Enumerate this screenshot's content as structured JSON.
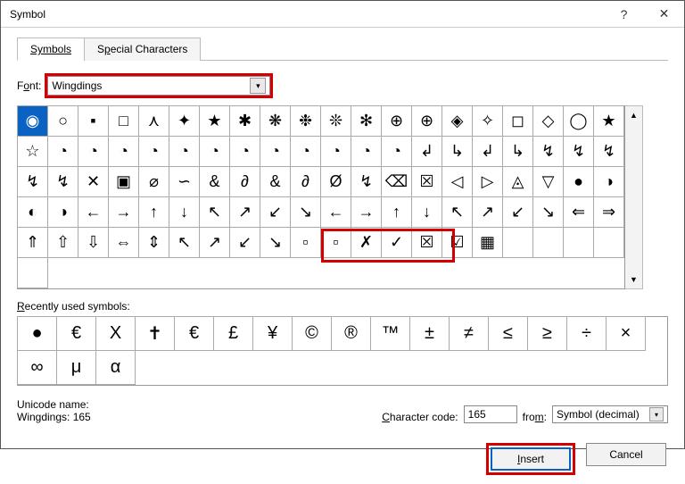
{
  "titlebar": {
    "title": "Symbol"
  },
  "tabs": {
    "symbols": "Symbols",
    "special": "Special Characters"
  },
  "fontrow": {
    "label_pre": "F",
    "label_u": "o",
    "label_post": "nt:",
    "value": "Wingdings"
  },
  "grid_rows": [
    [
      "◉",
      "○",
      "▪",
      "□",
      "⋏",
      "✦",
      "★",
      "✱",
      "❋",
      "❉",
      "❊",
      "✻",
      "⊕",
      "⊕",
      "◈",
      "✧",
      "◻",
      "◇",
      "◯",
      "★",
      "☆",
      "◔"
    ],
    [
      "◔",
      "◔",
      "◔",
      "◔",
      "◔",
      "◔",
      "◔",
      "◔",
      "◔",
      "◔",
      "◔",
      "↲",
      "↳",
      "↲",
      "↳",
      "↯",
      "↯",
      "↯",
      "↯",
      "↯"
    ],
    [
      "✕",
      "▣",
      "⌀",
      "∽",
      "&",
      "∂",
      "&",
      "∂",
      "Ø",
      "↯",
      "⌫",
      "☒",
      "◁",
      "▷",
      "◬",
      "▽",
      "●",
      "◑",
      "◐"
    ],
    [
      "◑",
      "←",
      "→",
      "↑",
      "↓",
      "↖",
      "↗",
      "↙",
      "↘",
      "←",
      "→",
      "↑",
      "↓",
      "↖",
      "↗",
      "↙",
      "↘",
      "⇐",
      "⇒",
      "⇑"
    ],
    [
      "⇧",
      "⇩",
      "⇔",
      "⇕",
      "↖",
      "↗",
      "↙",
      "↘",
      "▫",
      "▫",
      "✗",
      "✓",
      "☒",
      "☑",
      "▦",
      "",
      "",
      "",
      "",
      ""
    ]
  ],
  "recent_label_pre": "",
  "recent_label_u": "R",
  "recent_label_post": "ecently used symbols:",
  "recent": [
    "●",
    "€",
    "X",
    "✝",
    "€",
    "£",
    "¥",
    "©",
    "®",
    "™",
    "±",
    "≠",
    "≤",
    "≥",
    "÷",
    "×",
    "∞",
    "μ",
    "α"
  ],
  "unicode": {
    "label": "Unicode name:",
    "value": "Wingdings: 165"
  },
  "charcode": {
    "label_pre": "",
    "label_u": "C",
    "label_post": "haracter code:",
    "value": "165"
  },
  "from": {
    "label_pre": "fro",
    "label_u": "m",
    "label_post": ":",
    "value": "Symbol (decimal)"
  },
  "footer": {
    "insert_u": "I",
    "insert_post": "nsert",
    "cancel": "Cancel"
  }
}
